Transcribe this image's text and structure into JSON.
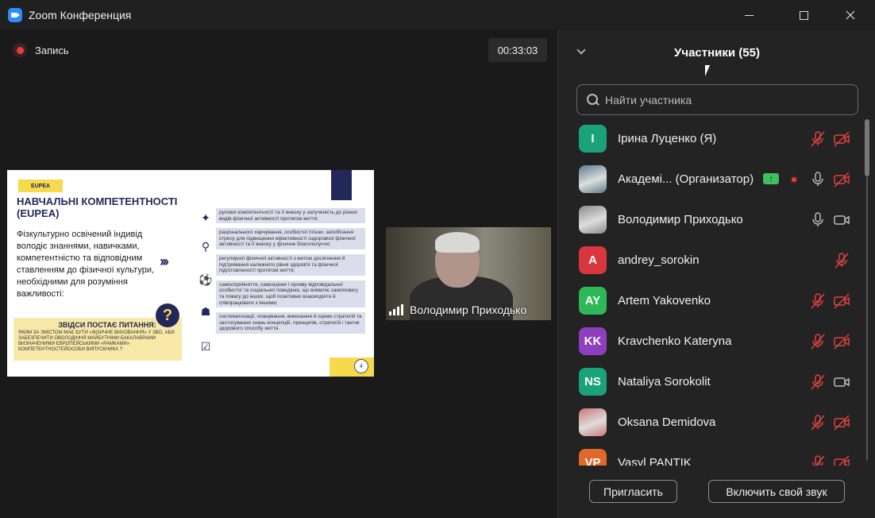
{
  "window": {
    "title": "Zoom Конференция"
  },
  "recording": {
    "label": "Запись"
  },
  "timer": "00:33:03",
  "slide": {
    "tag": "EUPEA",
    "heading": "НАВЧАЛЬНІ КОМПЕТЕНТНОСТІ (EUPEA)",
    "text": "Фізкультурно освічений індивід володіє знаннями, навичками, компетентністю та відповідним ставленням до фізичної культури, необхідними для розуміння важливості:",
    "arrows": "›››",
    "question_title": "ЗВІДСИ ПОСТАЄ ПИТАННЯ:",
    "question_text": "ЯКИМ ЗА ЗМІСТОМ МАЄ БУТИ «ФІЗИЧНЕ ВИХОВАННЯ» У ЗВО, АБИ ЗАБЕЗПЕЧИТИ ОВОЛОДІННЯ МАЙБУТНІМИ БАКАЛАВРАМИ ВИЗНАЧЕНИМИ ЄВРОПЕЙСЬКИМИ «РАМКАМИ» КОМПЕТЕНТНОСТЕЙОСОБИ ВИПУСКНИКА ?",
    "question_mark": "?",
    "items": [
      "руховоі компетентності та її внеску у залученість до різних видів фізичної активності протягом життя;",
      "раціонального харчування, особистої гігієни, запобігання стресу для підвищення ефективності оздоровчої фізичної активності та її внеску у фізичне благополуччя;",
      "регулярної фізичної активності з метою досягнення й підтримання належного рівня здоров'я та фізичної підготовленості протягом життя;",
      "самосприйняття, самооцінки і прояву відповідальної особистої та соціальної поведінки, що виявляє самоповагу та повагу до інших, щоб позитивно взаємодіяти й співпрацювати з іншими;",
      "систематизації, планування, виконання й оцінки стратегій та застосування знань концепцій, принципів, стратегій і тактик здорового способу життя."
    ],
    "page_number": "4"
  },
  "camera": {
    "name": "Володимир Приходько"
  },
  "panel": {
    "title": "Участники (55)",
    "search_placeholder": "Найти участника",
    "participants": [
      {
        "name": "Ірина Луценко (Я)",
        "initials": "I",
        "color": "#1aa37a",
        "photo": false,
        "mic": "muted",
        "video": "off"
      },
      {
        "name": "Академі...  (Организатор)",
        "initials": "",
        "color": "#5b7a8a",
        "photo": true,
        "mic": "on",
        "video": "off",
        "sharing": true,
        "recording": true
      },
      {
        "name": "Володимир Приходько",
        "initials": "",
        "color": "#8a8a8a",
        "photo": true,
        "mic": "on",
        "video": "on"
      },
      {
        "name": "andrey_sorokin",
        "initials": "A",
        "color": "#d9373f",
        "photo": false,
        "mic": "muted",
        "video": "none"
      },
      {
        "name": "Artem Yakovenko",
        "initials": "AY",
        "color": "#2fb85a",
        "photo": false,
        "mic": "muted",
        "video": "off"
      },
      {
        "name": "Kravchenko Kateryna",
        "initials": "KK",
        "color": "#8e3fbf",
        "photo": false,
        "mic": "muted",
        "video": "off"
      },
      {
        "name": "Nataliya Sorokolit",
        "initials": "NS",
        "color": "#1aa37a",
        "photo": false,
        "mic": "muted",
        "video": "on"
      },
      {
        "name": "Oksana Demidova",
        "initials": "",
        "color": "#c77",
        "photo": true,
        "mic": "muted",
        "video": "off"
      },
      {
        "name": "Vasyl PANTIK",
        "initials": "VP",
        "color": "#e0682a",
        "photo": false,
        "mic": "muted",
        "video": "off"
      }
    ],
    "invite_label": "Пригласить",
    "unmute_label": "Включить свой звук"
  }
}
